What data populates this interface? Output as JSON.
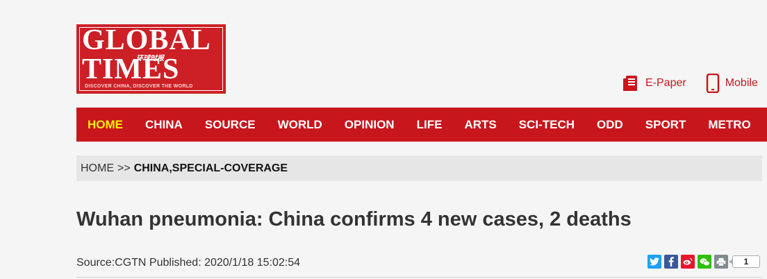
{
  "logo": {
    "line1": "GLOBAL",
    "line2": "TIMES",
    "chinese": "环球时报",
    "slogan": "DISCOVER CHINA, DISCOVER THE WORLD",
    "bg_color": "#cc1f26"
  },
  "header_links": [
    {
      "label": "E-Paper",
      "icon": "newspaper-icon"
    },
    {
      "label": "Mobile",
      "icon": "mobile-phone-icon"
    }
  ],
  "nav": {
    "items": [
      {
        "label": "HOME",
        "active": true
      },
      {
        "label": "CHINA"
      },
      {
        "label": "SOURCE"
      },
      {
        "label": "WORLD"
      },
      {
        "label": "OPINION"
      },
      {
        "label": "LIFE"
      },
      {
        "label": "ARTS"
      },
      {
        "label": "SCI-TECH"
      },
      {
        "label": "ODD"
      },
      {
        "label": "SPORT"
      },
      {
        "label": "METRO"
      }
    ],
    "bg_color": "#c8161d",
    "active_color": "#ffee00"
  },
  "breadcrumb": {
    "home": "HOME",
    "separator": ">>",
    "current": "CHINA,SPECIAL-COVERAGE"
  },
  "article": {
    "title": "Wuhan pneumonia: China confirms 4 new cases, 2 deaths",
    "meta": "Source:CGTN Published: 2020/1/18 15:02:54"
  },
  "share": {
    "buttons": [
      {
        "icon": "twitter-icon",
        "color": "#1da1f2",
        "glyph": "t"
      },
      {
        "icon": "facebook-icon",
        "color": "#3b5998",
        "glyph": "f"
      },
      {
        "icon": "weibo-icon",
        "color": "#e6162d",
        "glyph": "w"
      },
      {
        "icon": "wechat-icon",
        "color": "#2dc100",
        "glyph": "✉"
      },
      {
        "icon": "print-icon",
        "color": "#7f8c8d",
        "glyph": "⎙"
      }
    ],
    "count": "1"
  }
}
